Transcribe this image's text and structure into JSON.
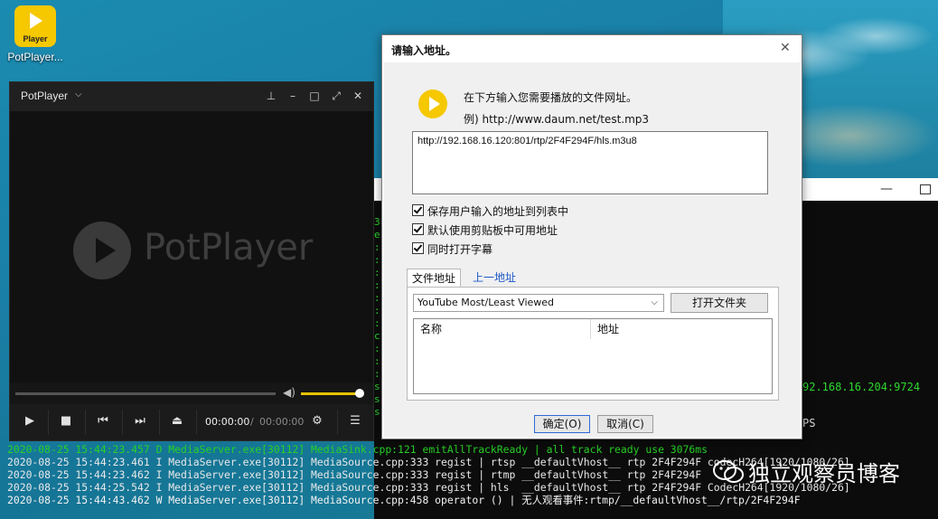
{
  "desktop": {
    "icon": {
      "label": "Player",
      "name": "PotPlayer..."
    }
  },
  "console": {
    "gutter": "3\ne\n:\n:\n:\n:\n:\n:\n:\nc\n:\n:\n:\ns\ns\ns",
    "right_ip": "92.168.16.204:9724",
    "right_ps": "PS",
    "log": [
      {
        "level": "D",
        "text": "2020-08-25 15:44:23.457 D MediaServer.exe[30112] MediaSink.cpp:121 emitAllTrackReady | all track ready use 3076ms"
      },
      {
        "level": "I",
        "text": "2020-08-25 15:44:23.461 I MediaServer.exe[30112] MediaSource.cpp:333 regist | rtsp __defaultVhost__ rtp 2F4F294F codecH264[1920/1080/26]"
      },
      {
        "level": "I",
        "text": "2020-08-25 15:44:23.462 I MediaServer.exe[30112] MediaSource.cpp:333 regist | rtmp __defaultVhost__ rtp 2F4F294F"
      },
      {
        "level": "I",
        "text": "2020-08-25 15:44:25.542 I MediaServer.exe[30112] MediaSource.cpp:333 regist | hls  __defaultVhost__ rtp 2F4F294F CodecH264[1920/1080/26]"
      },
      {
        "level": "W",
        "text": "2020-08-25 15:44:43.462 W MediaServer.exe[30112] MediaSource.cpp:458 operator () | 无人观看事件:rtmp/__defaultVhost__/rtp/2F4F294F"
      }
    ]
  },
  "player": {
    "title": "PotPlayer",
    "brand": "PotPlayer",
    "time_current": "00:00:00",
    "time_sep": "/",
    "time_total": "00:00:00",
    "volume": 0.9
  },
  "dialog": {
    "title": "请输入地址。",
    "prompt": "在下方输入您需要播放的文件网址。",
    "example": "例) http://www.daum.net/test.mp3",
    "url": "http://192.168.16.120:801/rtp/2F4F294F/hls.m3u8",
    "checkboxes": [
      {
        "label": "保存用户输入的地址到列表中",
        "checked": true
      },
      {
        "label": "默认使用剪贴板中可用地址",
        "checked": true
      },
      {
        "label": "同时打开字幕",
        "checked": true
      }
    ],
    "tabs": [
      {
        "label": "文件地址"
      },
      {
        "label": "上一地址"
      }
    ],
    "source_select": "YouTube Most/Least Viewed",
    "open_folder": "打开文件夹",
    "columns": [
      "名称",
      "地址"
    ],
    "ok": "确定(O)",
    "cancel": "取消(C)"
  },
  "watermark": "独立观察员博客"
}
